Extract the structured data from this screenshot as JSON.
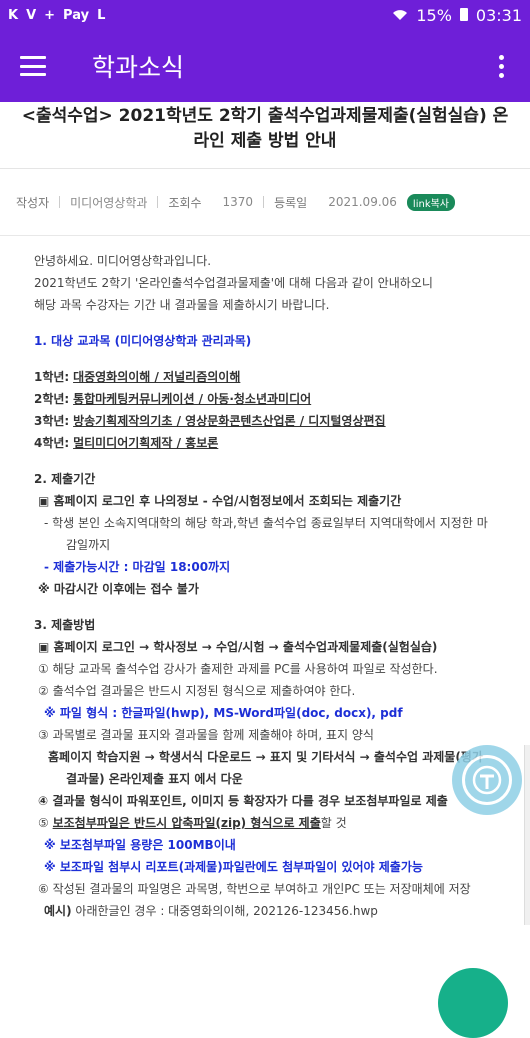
{
  "status": {
    "left_icons": [
      "K",
      "V",
      "+",
      "Pay",
      "L"
    ],
    "battery": "15%",
    "time": "03:31"
  },
  "appbar": {
    "title": "학과소식"
  },
  "article": {
    "title": "<출석수업> 2021학년도 2학기 출석수업과제물제출(실험실습) 온라인 제출 방법 안내",
    "meta": {
      "author_label": "작성자",
      "author": "미디어영상학과",
      "views_label": "조회수",
      "views": "1370",
      "date_label": "등록일",
      "date": "2021.09.06",
      "link_copy": "link복사"
    }
  },
  "content": {
    "intro1": "안녕하세요. 미디어영상학과입니다.",
    "intro2": "2021학년도 2학기 '온라인출석수업결과물제출'에 대해 다음과 같이 안내하오니",
    "intro3": "해당 과목 수강자는 기간 내 결과물을 제출하시기 바랍니다.",
    "sec1_title": "1. 대상 교과목 (미디어영상학과 관리과목)",
    "grade1_label": "1학년:",
    "grade1": "대중영화의이해 / 저널리즘의이해",
    "grade2_label": "2학년:",
    "grade2": "통합마케팅커뮤니케이션 / 아동·청소년과미디어",
    "grade3_label": "3학년:",
    "grade3": "방송기획제작의기초 / 영상문화콘텐츠산업론 / 디지털영상편집",
    "grade4_label": "4학년:",
    "grade4": "멀티미디어기획제작 / 홍보론",
    "sec2_title": "2. 제출기간",
    "sec2_item": "▣ 홈페이지 로그인 후 나의정보 - 수업/시험정보에서 조회되는 제출기간",
    "sec2_sub1a": "- 학생 본인 소속지역대학의 해당 학과,학년 출석수업 종료일부터 지역대학에서 지정한 마",
    "sec2_sub1b": "감일까지",
    "sec2_sub2": "- 제출가능시간 : 마감일 18:00까지",
    "sec2_note": "※ 마감시간 이후에는 접수 불가",
    "sec3_title": "3. 제출방법",
    "sec3_path": "▣ 홈페이지 로그인 → 학사정보 → 수업/시험 → 출석수업과제물제출(실험실습)",
    "step1": "① 해당 교과목 출석수업 강사가 출제한 과제를 PC를 사용하여 파일로 작성한다.",
    "step2": "② 출석수업 결과물은 반드시 지정된 형식으로 제출하여야 한다.",
    "step2_note": "※ 파일 형식 : 한글파일(hwp), MS-Word파일(doc, docx), pdf",
    "step3": "③ 과목별로 결과물 표지와 결과물을 함께 제출해야 하며, 표지 양식",
    "step3_path_a": "홈페이지 학습지원 → 학생서식 다운로드 → 표지 및 기타서식 → 출석수업 과제물(평가",
    "step3_path_b": "결과물) 온라인제출 표지 에서 다운",
    "step4": "④ 결과물 형식이 파워포인트, 이미지 등 확장자가 다를 경우 보조첨부파일로 제출",
    "step5_num": "⑤",
    "step5_u": "보조첨부파일은 반드시 압축파일(zip) 형식으로 제출",
    "step5_tail": "할 것",
    "step5_note1": "※ 보조첨부파일 용량은 100MB이내",
    "step5_note2": "※ 보조파일 첨부시 리포트(과제물)파일란에도 첨부파일이 있어야 제출가능",
    "step6": "⑥ 작성된 결과물의 파일명은 과목명, 학번으로 부여하고 개인PC 또는 저장매체에 저장",
    "example_label": "예시)",
    "example": "아래한글인 경우 : 대중영화의이해, 202126-123456.hwp"
  },
  "colors": {
    "primary": "#6e1fd8",
    "link_blue": "#1d2fd6",
    "badge_green": "#1a8a5a"
  },
  "icons": [
    "menu-icon",
    "more-vert-icon",
    "accessibility-icon",
    "edit-fab-icon"
  ]
}
